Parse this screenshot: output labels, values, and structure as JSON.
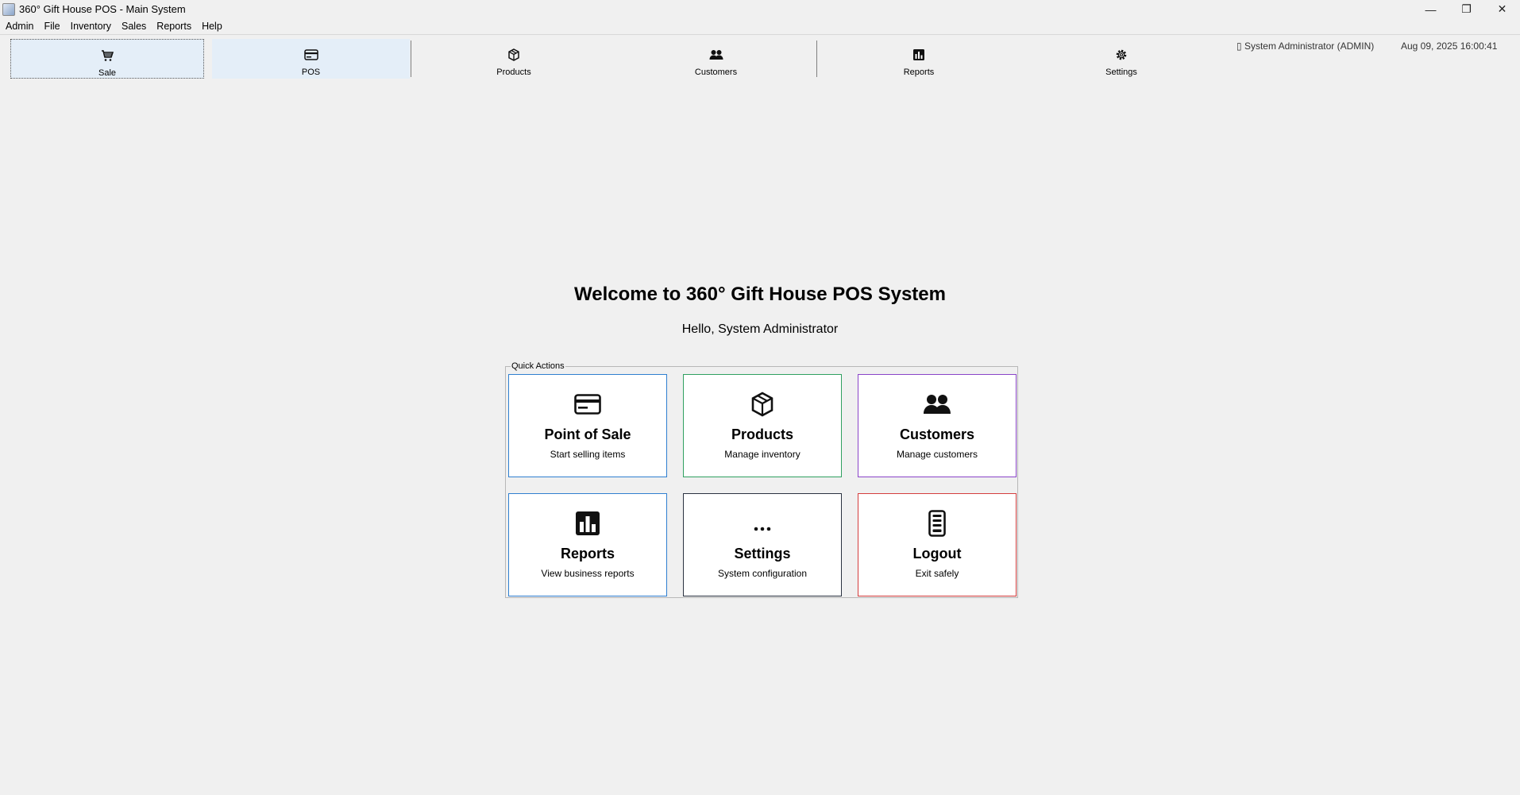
{
  "window": {
    "title": "360° Gift House POS - Main System",
    "controls": {
      "minimize": "—",
      "maximize": "❐",
      "close": "✕"
    }
  },
  "menubar": {
    "items": [
      {
        "label": "Admin"
      },
      {
        "label": "File"
      },
      {
        "label": "Inventory"
      },
      {
        "label": "Sales"
      },
      {
        "label": "Reports"
      },
      {
        "label": "Help"
      }
    ]
  },
  "toolbar": {
    "buttons": [
      {
        "label": "Sale",
        "icon": "cart-icon"
      },
      {
        "label": "POS",
        "icon": "card-icon"
      },
      {
        "label": "Products",
        "icon": "box-icon"
      },
      {
        "label": "Customers",
        "icon": "users-icon"
      },
      {
        "label": "Reports",
        "icon": "bar-chart-icon"
      },
      {
        "label": "Settings",
        "icon": "gear-icon"
      }
    ],
    "user": "▯ System Administrator (ADMIN)",
    "datetime": "Aug 09, 2025 16:00:41"
  },
  "main": {
    "welcome": "Welcome to 360° Gift House POS System",
    "hello": "Hello, System Administrator",
    "quick_actions_label": "Quick Actions",
    "cards": [
      {
        "title": "Point of Sale",
        "subtitle": "Start selling items",
        "icon": "card-icon",
        "color": "#2f7fd0"
      },
      {
        "title": "Products",
        "subtitle": "Manage inventory",
        "icon": "box-icon",
        "color": "#2fa060"
      },
      {
        "title": "Customers",
        "subtitle": "Manage customers",
        "icon": "users-icon",
        "color": "#8a44c8"
      },
      {
        "title": "Reports",
        "subtitle": "View business reports",
        "icon": "bar-chart-icon",
        "color": "#2f7fd0"
      },
      {
        "title": "Settings",
        "subtitle": "System configuration",
        "icon": "ellipsis-icon",
        "color": "#2a3240"
      },
      {
        "title": "Logout",
        "subtitle": "Exit safely",
        "icon": "phone-icon",
        "color": "#d43d3d"
      }
    ]
  }
}
